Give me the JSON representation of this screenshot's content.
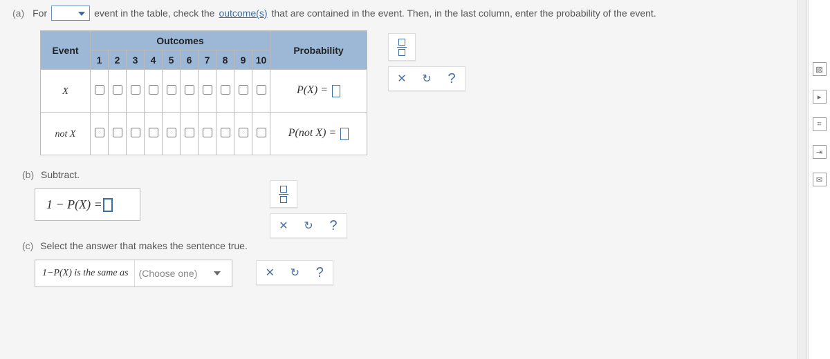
{
  "a": {
    "label": "(a)",
    "word_for": "For",
    "instr_before_link": "event in the table, check the",
    "link_text": "outcome(s)",
    "instr_after_link": "that are contained in the event. Then, in the last column, enter the probability of the event."
  },
  "table": {
    "event_hdr": "Event",
    "outcomes_hdr": "Outcomes",
    "prob_hdr": "Probability",
    "numbers": [
      "1",
      "2",
      "3",
      "4",
      "5",
      "6",
      "7",
      "8",
      "9",
      "10"
    ],
    "row_x_label": "X",
    "row_notx_label": "not X",
    "prob_x": "P(X) = ",
    "prob_notx": "P(not X) = "
  },
  "controls": {
    "x_label": "✕",
    "redo_label": "↻",
    "help_label": "?"
  },
  "b": {
    "label": "(b)",
    "title": "Subtract.",
    "equation": "1 − P(X) = "
  },
  "c": {
    "label": "(c)",
    "title": "Select the answer that makes the sentence true.",
    "lhs": "1−P(X) is the same as",
    "choose": "(Choose one)"
  },
  "rail_icons": [
    "▨",
    "▸",
    "⌗",
    "⇥",
    "✉"
  ]
}
